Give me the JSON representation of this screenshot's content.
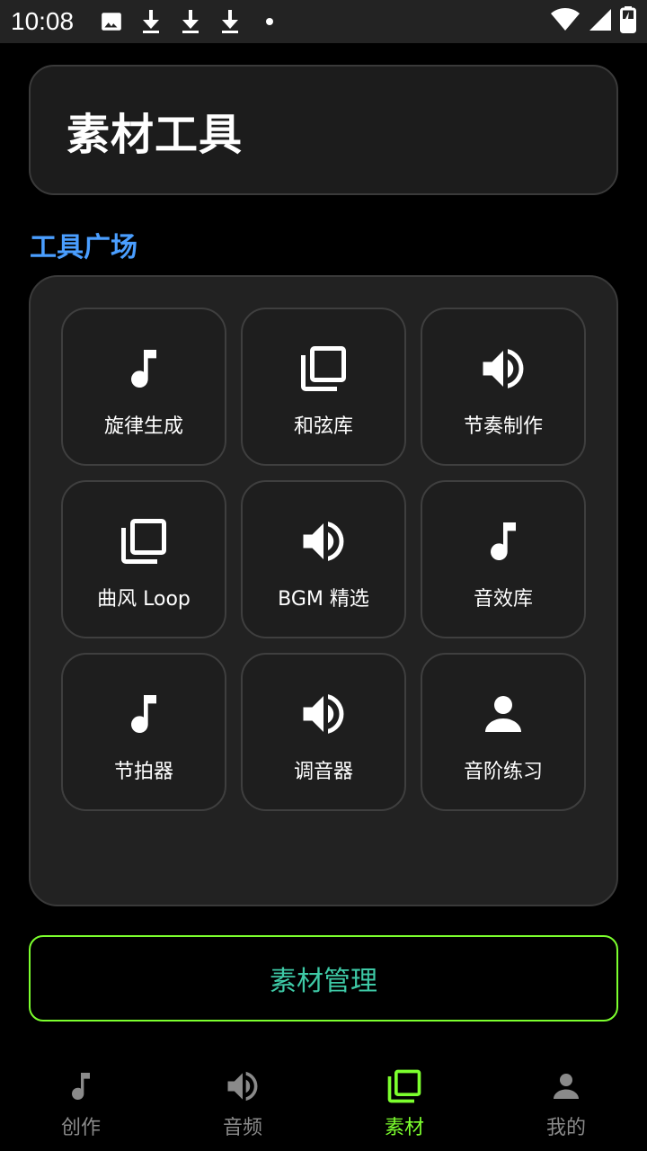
{
  "status_bar": {
    "time": "10:08",
    "left_icons": [
      "image-icon",
      "download-icon",
      "download-icon",
      "download-icon",
      "dot-icon"
    ],
    "right_icons": [
      "wifi-icon",
      "signal-icon",
      "battery-charging-icon"
    ]
  },
  "header": {
    "title": "素材工具"
  },
  "section": {
    "label": "工具广场"
  },
  "tools": [
    {
      "label": "旋律生成",
      "icon": "music-note-icon"
    },
    {
      "label": "和弦库",
      "icon": "library-icon"
    },
    {
      "label": "节奏制作",
      "icon": "speaker-icon"
    },
    {
      "label": "曲风 Loop",
      "icon": "library-icon"
    },
    {
      "label": "BGM 精选",
      "icon": "speaker-icon"
    },
    {
      "label": "音效库",
      "icon": "music-note-icon"
    },
    {
      "label": "节拍器",
      "icon": "music-note-icon"
    },
    {
      "label": "调音器",
      "icon": "speaker-icon"
    },
    {
      "label": "音阶练习",
      "icon": "person-icon"
    }
  ],
  "manage": {
    "label": "素材管理"
  },
  "nav": {
    "items": [
      {
        "label": "创作",
        "icon": "music-note-icon",
        "active": false
      },
      {
        "label": "音频",
        "icon": "speaker-icon",
        "active": false
      },
      {
        "label": "素材",
        "icon": "library-icon",
        "active": true
      },
      {
        "label": "我的",
        "icon": "person-icon",
        "active": false
      }
    ]
  },
  "colors": {
    "accent_blue": "#4a9eff",
    "accent_green": "#7cff2e",
    "manage_text": "#3ec9a6",
    "inactive_nav": "#8a8a8a"
  }
}
